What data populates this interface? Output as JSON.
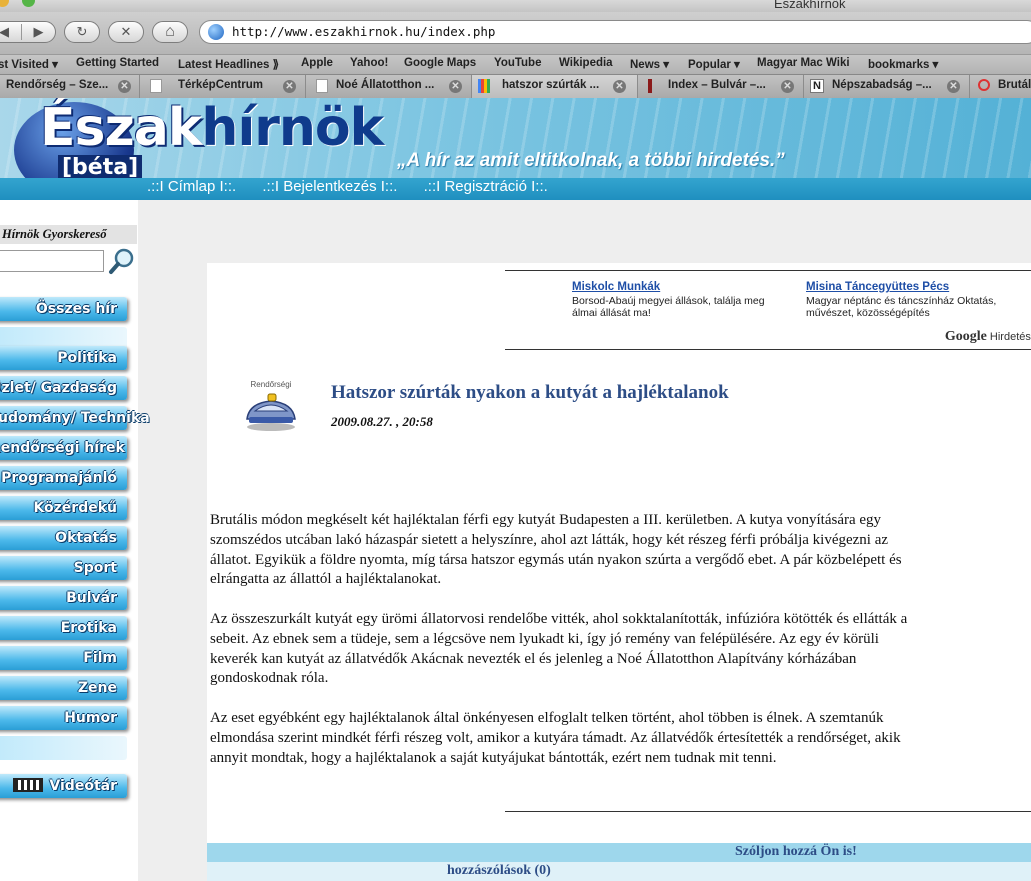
{
  "browser": {
    "window_title": "Északhírnök",
    "back_glyph": "◀",
    "forward_glyph": "▶",
    "reload_glyph": "↻",
    "stop_glyph": "✕",
    "home_glyph": "⌂",
    "url": "http://www.eszakhirnok.hu/index.php",
    "bookmarks": [
      "st Visited ▾",
      "Getting Started",
      "Latest Headlines ⟫",
      "Apple",
      "Yahoo!",
      "Google Maps",
      "YouTube",
      "Wikipedia",
      "News ▾",
      "Popular ▾",
      "Magyar Mac Wiki",
      "bookmarks ▾"
    ],
    "tabs": [
      {
        "label": "Rendőrség – Sze..."
      },
      {
        "label": "TérképCentrum"
      },
      {
        "label": "Noé Állatotthon ..."
      },
      {
        "label": "hatszor szúrták ..."
      },
      {
        "label": "Index – Bulvár –..."
      },
      {
        "label": "Népszabadság –..."
      },
      {
        "label": "Brutál"
      }
    ],
    "tab_close_glyph": "✕"
  },
  "site": {
    "logo_main": "Északhírnök",
    "logo_main_a": "Észak",
    "logo_main_b": "hírnök",
    "logo_badge": "[béta]",
    "slogan": "„A hír az amit eltitkolnak, a többi hirdetés.”",
    "nav": [
      ".::I Címlap I::.",
      ".::I Bejelentkezés I::.",
      ".::I Regisztráció I::."
    ]
  },
  "sidebar": {
    "search_title": "Hírnök Gyorskereső",
    "search_value": "",
    "menu": [
      {
        "label": "Összes hír"
      },
      {
        "label": "Politika"
      },
      {
        "label": "Üzlet/ Gazdaság"
      },
      {
        "label": "Tudomány/ Technika"
      },
      {
        "label": "Rendőrségi hírek"
      },
      {
        "label": "Programajánló"
      },
      {
        "label": "Közérdekű"
      },
      {
        "label": "Oktatás"
      },
      {
        "label": "Sport"
      },
      {
        "label": "Bulvár"
      },
      {
        "label": "Erotika"
      },
      {
        "label": "Film"
      },
      {
        "label": "Zene"
      },
      {
        "label": "Humor"
      }
    ],
    "video_label": "Videótár"
  },
  "ads": {
    "items": [
      {
        "title": "Miskolc Munkák",
        "text": "Borsod-Abaúj megyei állások, találja meg álmai állását ma!"
      },
      {
        "title": "Misina Táncegyüttes Pécs",
        "text": "Magyar néptánc és táncszínház Oktatás, művészet, közösségépítés"
      }
    ],
    "google_word": "Google",
    "google_suffix": "Hirdetése"
  },
  "article": {
    "category_icon_label": "Rendőrségi",
    "title": "Hatszor szúrták nyakon a kutyát a hajléktalanok",
    "date": "2009.08.27. , 20:58",
    "paragraphs": [
      "Brutális módon megkéselt két hajléktalan férfi egy kutyát Budapesten a III. kerületben. A kutya vonyítására egy szomszédos utcában lakó házaspár sietett a helyszínre, ahol azt látták, hogy két részeg férfi próbálja kivégezni az állatot. Egyikük a földre nyomta, míg társa hatszor egymás után nyakon szúrta a vergődő ebet. A pár közbelépett és elrángatta az állattól a hajléktalanokat.",
      "Az összeszurkált kutyát egy ürömi állatorvosi rendelőbe vitték, ahol sokktalanították, infúzióra kötötték és ellátták a sebeit. Az ebnek sem a tüdeje, sem a légcsöve nem lyukadt ki, így jó remény van felépülésére. Az egy év körüli keverék kan kutyát az állatvédők Akácnak nevezték el és jelenleg a Noé Állatotthon Alapítvány kórházában gondoskodnak róla.",
      "Az eset egyébként egy hajléktalanok által önkényesen elfoglalt telken történt, ahol többen is élnek. A szemtanúk elmondása szerint mindkét férfi részeg volt, amikor a kutyára támadt. Az állatvédők értesítették a rendőrséget, akik annyit mondtak, hogy a hajléktalanok a saját kutyájukat bántották, ezért nem tudnak mit tenni."
    ],
    "comment_cta": "Szóljon hozzá Ön is!",
    "comment_count": "hozzászólások (0)"
  },
  "colors": {
    "header_stripe": "#1f8fbf",
    "menu_button": "#4bb8ea",
    "title_blue": "#2d4d86",
    "comment_bar": "#9ed7ec"
  }
}
